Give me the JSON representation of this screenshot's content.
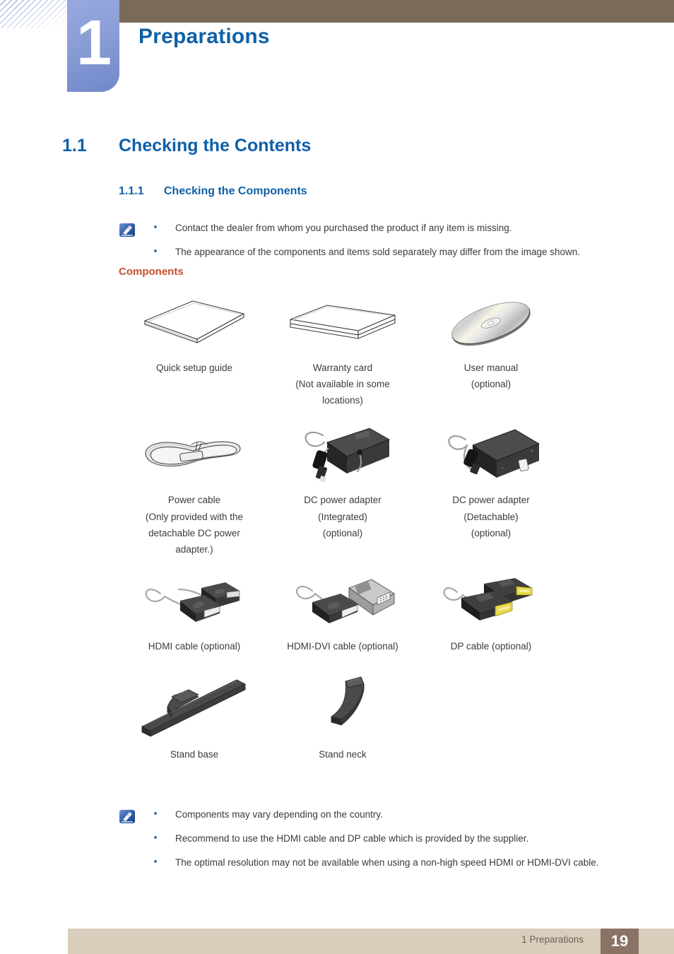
{
  "header": {
    "chapter_number": "1",
    "chapter_title": "Preparations"
  },
  "headings": {
    "h1_number": "1.1",
    "h1_title": "Checking the Contents",
    "h2_number": "1.1.1",
    "h2_title": "Checking the Components",
    "components_label": "Components"
  },
  "note_top": {
    "icon": "note-pencil-icon",
    "bullets": [
      "Contact the dealer from whom you purchased the product if any item is missing.",
      "The appearance of the components and items sold separately may differ from the image shown."
    ]
  },
  "note_bottom": {
    "icon": "note-pencil-icon",
    "bullets": [
      "Components may vary depending on the country.",
      "Recommend to use the HDMI cable and DP cable which is provided by the supplier.",
      "The optimal resolution may not be available when using a non-high speed HDMI or HDMI-DVI cable."
    ]
  },
  "components": {
    "rows": [
      [
        {
          "icon": "quick-setup-guide-icon",
          "lines": [
            "Quick setup guide"
          ]
        },
        {
          "icon": "warranty-card-icon",
          "lines": [
            "Warranty card",
            "(Not available in some",
            "locations)"
          ]
        },
        {
          "icon": "user-manual-disc-icon",
          "lines": [
            "User manual",
            "(optional)"
          ]
        }
      ],
      [
        {
          "icon": "power-cable-icon",
          "lines": [
            "Power cable",
            "(Only provided with the",
            "detachable DC power",
            "adapter.)"
          ]
        },
        {
          "icon": "dc-power-adapter-integrated-icon",
          "lines": [
            "DC power adapter",
            "(Integrated)",
            "(optional)"
          ]
        },
        {
          "icon": "dc-power-adapter-detachable-icon",
          "lines": [
            "DC power adapter",
            "(Detachable)",
            "(optional)"
          ]
        }
      ],
      [
        {
          "icon": "hdmi-cable-icon",
          "lines": [
            "HDMI cable (optional)"
          ]
        },
        {
          "icon": "hdmi-dvi-cable-icon",
          "lines": [
            "HDMI-DVI cable (optional)"
          ]
        },
        {
          "icon": "dp-cable-icon",
          "lines": [
            "DP cable (optional)"
          ]
        }
      ],
      [
        {
          "icon": "stand-base-icon",
          "lines": [
            "Stand base"
          ]
        },
        {
          "icon": "stand-neck-icon",
          "lines": [
            "Stand neck"
          ]
        }
      ]
    ]
  },
  "footer": {
    "chapter_ref": "1 Preparations",
    "page_number": "19"
  },
  "colors": {
    "accent_blue": "#1060a8",
    "accent_orange": "#c2512e",
    "header_brown": "#796b58",
    "footer_tan": "#d9cdbb",
    "page_box": "#8a7365",
    "chapter_blue": "#8b9ed6"
  }
}
